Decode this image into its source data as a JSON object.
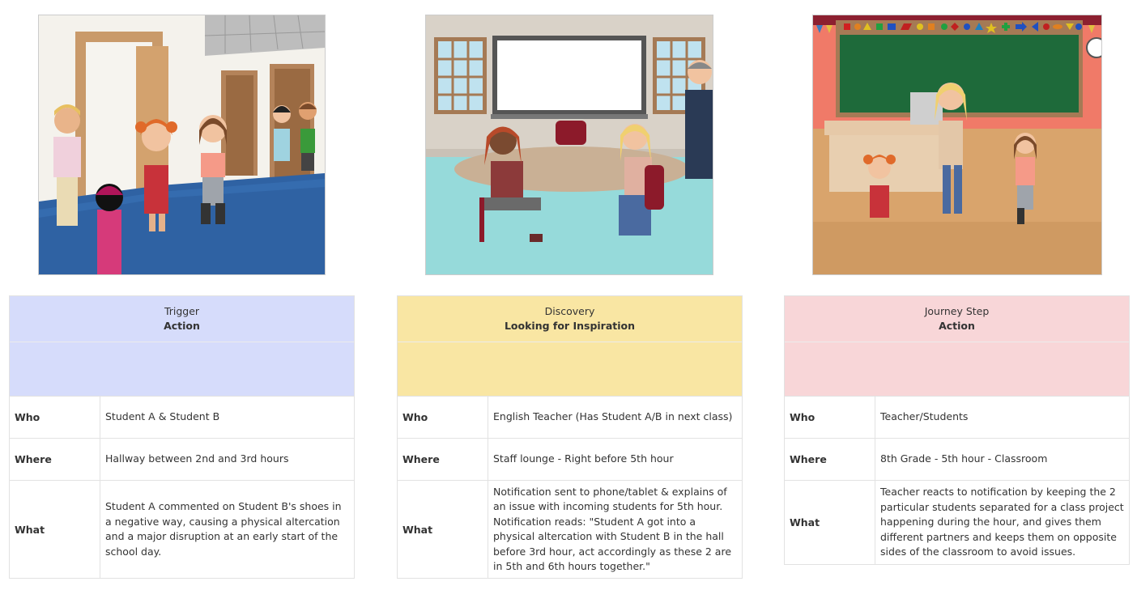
{
  "panels": [
    {
      "stage": "Trigger",
      "title": "Action",
      "color": "#d6dcfb",
      "who_label": "Who",
      "where_label": "Where",
      "what_label": "What",
      "who": "Student A & Student B",
      "where": "Hallway between 2nd and 3rd hours",
      "what": "Student A commented on Student B's shoes in a negative way, causing a physical altercation and a major disruption at an early start of the school day.",
      "scene": "hallway"
    },
    {
      "stage": "Discovery",
      "title": "Looking for Inspiration",
      "color": "#f9e6a3",
      "who_label": "Who",
      "where_label": "Where",
      "what_label": "What",
      "who": "English Teacher (Has Student A/B in next class)",
      "where": "Staff lounge - Right before 5th hour",
      "what": "Notification sent to phone/tablet & explains of an issue with incoming students for 5th hour. Notification reads: \"Student A got into a physical altercation with Student B in the hall before 3rd hour, act accordingly as these 2 are in 5th and 6th hours together.\"",
      "scene": "staff-lounge"
    },
    {
      "stage": "Journey Step",
      "title": "Action",
      "color": "#f8d6d8",
      "who_label": "Who",
      "where_label": "Where",
      "what_label": "What",
      "who": "Teacher/Students",
      "where": "8th Grade - 5th hour - Classroom",
      "what": "Teacher reacts to notification by keeping the 2 particular students separated for a class project happening during the hour, and gives them different partners and keeps them on opposite sides of the classroom to avoid issues.",
      "scene": "classroom"
    }
  ]
}
